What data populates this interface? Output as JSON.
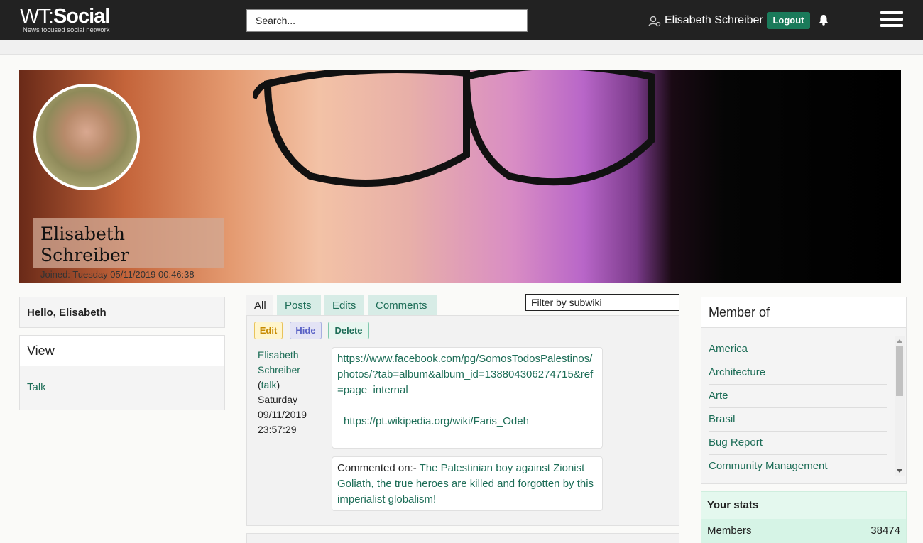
{
  "header": {
    "logo_wt": "WT:",
    "logo_social": "Social",
    "logo_tagline": "News focused social network",
    "search_placeholder": "Search...",
    "user_name": "Elisabeth Schreiber",
    "logout_label": "Logout"
  },
  "profile": {
    "name": "Elisabeth Schreiber",
    "joined": "Joined: Tuesday 05/11/2019 00:46:38"
  },
  "left": {
    "greeting": "Hello, Elisabeth",
    "view_title": "View",
    "view_link": "Talk"
  },
  "tabs": [
    "All",
    "Posts",
    "Edits",
    "Comments"
  ],
  "filter_placeholder": "Filter by subwiki",
  "post": {
    "actions": {
      "edit": "Edit",
      "hide": "Hide",
      "delete": "Delete"
    },
    "author_first": "Elisabeth",
    "author_last": "Schreiber",
    "talk": "talk",
    "date_day": "Saturday",
    "date": "09/11/2019",
    "time": "23:57:29",
    "link1": "https://www.facebook.com/pg/SomosTodosPalestinos/photos/?tab=album&album_id=138804306274715&ref=page_internal",
    "link2": "https://pt.wikipedia.org/wiki/Faris_Odeh",
    "comment_prefix": "Commented on:- ",
    "comment_title": "The Palestinian boy against Zionist Goliath, the true heroes are killed and forgotten by this imperialist globalism!"
  },
  "member_of": {
    "title": "Member of",
    "items": [
      "America",
      "Architecture",
      "Arte",
      "Brasil",
      "Bug Report",
      "Community Management"
    ]
  },
  "stats": {
    "title": "Your stats",
    "members_label": "Members",
    "members_value": "38474"
  },
  "colors": {
    "topbar": "#222222",
    "accent": "#1a7a5a",
    "link": "#1d6d57"
  }
}
